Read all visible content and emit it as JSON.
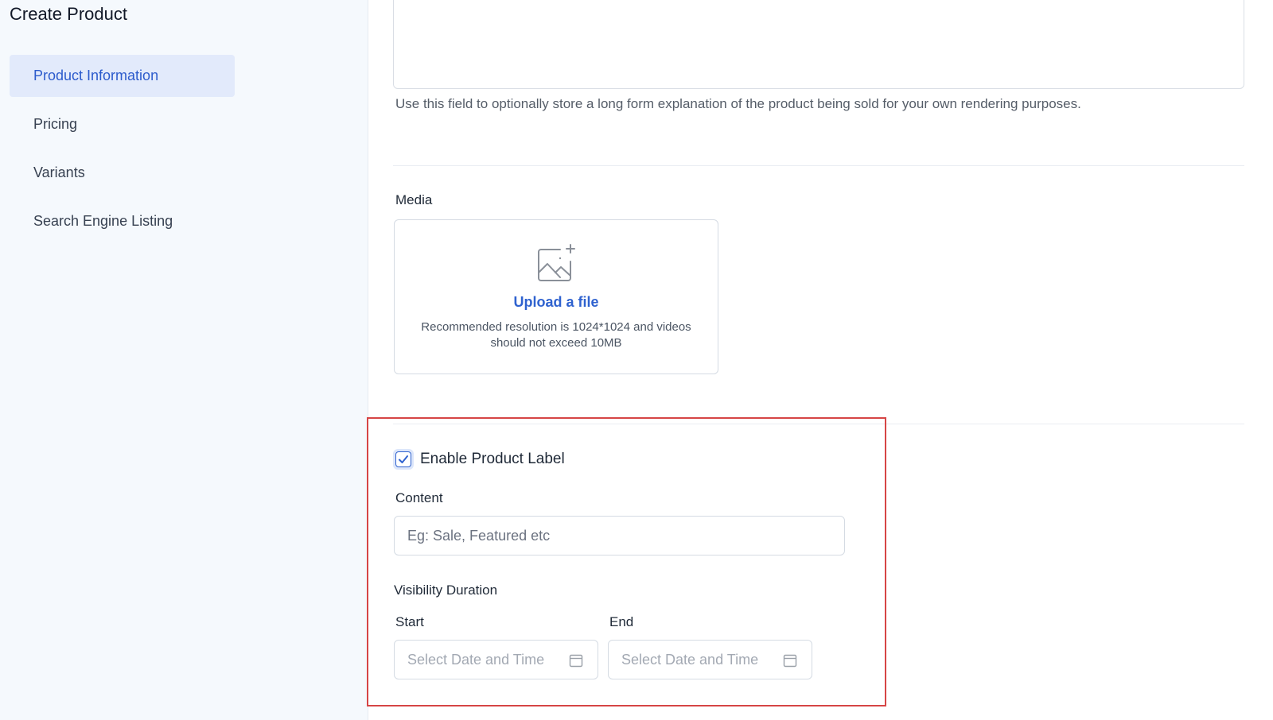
{
  "page": {
    "title": "Create Product"
  },
  "sidebar": {
    "items": [
      {
        "label": "Product Information",
        "active": true
      },
      {
        "label": "Pricing",
        "active": false
      },
      {
        "label": "Variants",
        "active": false
      },
      {
        "label": "Search Engine Listing",
        "active": false
      }
    ]
  },
  "description": {
    "help_text": "Use this field to optionally store a long form explanation of the product being sold for your own rendering purposes."
  },
  "media": {
    "label": "Media",
    "upload_link": "Upload a file",
    "upload_hint": "Recommended resolution is 1024*1024 and videos should not exceed 10MB",
    "icon": "image-plus-icon"
  },
  "product_label": {
    "checkbox_label": "Enable Product Label",
    "checked": true,
    "content_label": "Content",
    "content_placeholder": "Eg: Sale, Featured etc",
    "content_value": "",
    "visibility_label": "Visibility Duration",
    "start_label": "Start",
    "end_label": "End",
    "start_placeholder": "Select Date and Time",
    "end_placeholder": "Select Date and Time",
    "date_icon": "calendar-icon"
  },
  "colors": {
    "accent": "#2f62cf",
    "active_nav_bg": "#e2eafb",
    "sidebar_bg": "#f5f9fd",
    "highlight_border": "#d64545"
  }
}
